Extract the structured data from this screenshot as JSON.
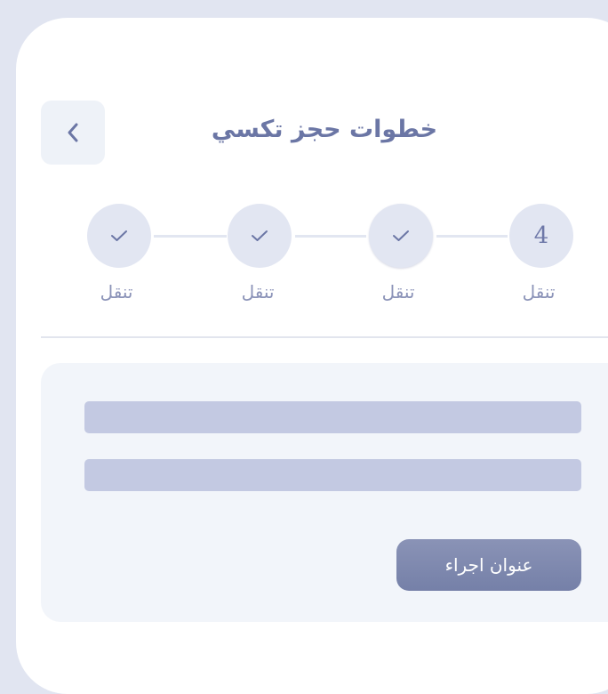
{
  "header": {
    "title": "خطوات حجز تكسي",
    "back_icon": "chevron-left-icon"
  },
  "stepper": {
    "steps": [
      {
        "label": "تنقل",
        "status": "complete",
        "icon": "check-icon"
      },
      {
        "label": "تنقل",
        "status": "complete",
        "icon": "check-icon"
      },
      {
        "label": "تنقل",
        "status": "current",
        "icon": "check-icon"
      },
      {
        "label": "تنقل",
        "status": "upcoming",
        "number": "4"
      }
    ]
  },
  "form": {
    "field_1_value": "",
    "field_2_value": "",
    "action_label": "عنوان اجراء"
  },
  "colors": {
    "background": "#e1e5f1",
    "accent": "#6b76a5",
    "field": "#c3c9e2",
    "button": "#7b85ac"
  }
}
